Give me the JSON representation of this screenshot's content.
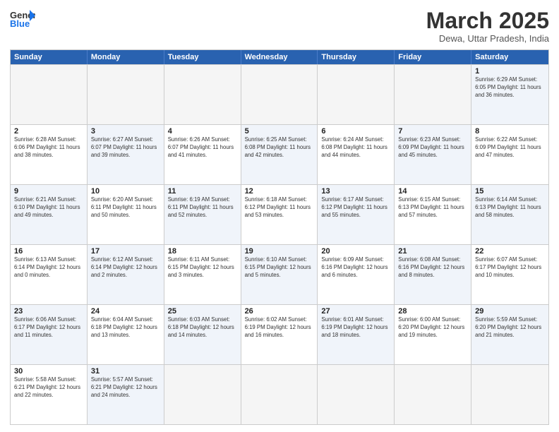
{
  "header": {
    "logo_general": "General",
    "logo_blue": "Blue",
    "month_title": "March 2025",
    "subtitle": "Dewa, Uttar Pradesh, India"
  },
  "days_of_week": [
    "Sunday",
    "Monday",
    "Tuesday",
    "Wednesday",
    "Thursday",
    "Friday",
    "Saturday"
  ],
  "weeks": [
    [
      {
        "day": "",
        "info": "",
        "empty": true
      },
      {
        "day": "",
        "info": "",
        "empty": true
      },
      {
        "day": "",
        "info": "",
        "empty": true
      },
      {
        "day": "",
        "info": "",
        "empty": true
      },
      {
        "day": "",
        "info": "",
        "empty": true
      },
      {
        "day": "",
        "info": "",
        "empty": true
      },
      {
        "day": "1",
        "info": "Sunrise: 6:29 AM\nSunset: 6:05 PM\nDaylight: 11 hours\nand 36 minutes.",
        "alt": true
      }
    ],
    [
      {
        "day": "2",
        "info": "Sunrise: 6:28 AM\nSunset: 6:06 PM\nDaylight: 11 hours\nand 38 minutes."
      },
      {
        "day": "3",
        "info": "Sunrise: 6:27 AM\nSunset: 6:07 PM\nDaylight: 11 hours\nand 39 minutes.",
        "alt": true
      },
      {
        "day": "4",
        "info": "Sunrise: 6:26 AM\nSunset: 6:07 PM\nDaylight: 11 hours\nand 41 minutes."
      },
      {
        "day": "5",
        "info": "Sunrise: 6:25 AM\nSunset: 6:08 PM\nDaylight: 11 hours\nand 42 minutes.",
        "alt": true
      },
      {
        "day": "6",
        "info": "Sunrise: 6:24 AM\nSunset: 6:08 PM\nDaylight: 11 hours\nand 44 minutes."
      },
      {
        "day": "7",
        "info": "Sunrise: 6:23 AM\nSunset: 6:09 PM\nDaylight: 11 hours\nand 45 minutes.",
        "alt": true
      },
      {
        "day": "8",
        "info": "Sunrise: 6:22 AM\nSunset: 6:09 PM\nDaylight: 11 hours\nand 47 minutes."
      }
    ],
    [
      {
        "day": "9",
        "info": "Sunrise: 6:21 AM\nSunset: 6:10 PM\nDaylight: 11 hours\nand 49 minutes.",
        "alt": true
      },
      {
        "day": "10",
        "info": "Sunrise: 6:20 AM\nSunset: 6:11 PM\nDaylight: 11 hours\nand 50 minutes."
      },
      {
        "day": "11",
        "info": "Sunrise: 6:19 AM\nSunset: 6:11 PM\nDaylight: 11 hours\nand 52 minutes.",
        "alt": true
      },
      {
        "day": "12",
        "info": "Sunrise: 6:18 AM\nSunset: 6:12 PM\nDaylight: 11 hours\nand 53 minutes."
      },
      {
        "day": "13",
        "info": "Sunrise: 6:17 AM\nSunset: 6:12 PM\nDaylight: 11 hours\nand 55 minutes.",
        "alt": true
      },
      {
        "day": "14",
        "info": "Sunrise: 6:15 AM\nSunset: 6:13 PM\nDaylight: 11 hours\nand 57 minutes."
      },
      {
        "day": "15",
        "info": "Sunrise: 6:14 AM\nSunset: 6:13 PM\nDaylight: 11 hours\nand 58 minutes.",
        "alt": true
      }
    ],
    [
      {
        "day": "16",
        "info": "Sunrise: 6:13 AM\nSunset: 6:14 PM\nDaylight: 12 hours\nand 0 minutes."
      },
      {
        "day": "17",
        "info": "Sunrise: 6:12 AM\nSunset: 6:14 PM\nDaylight: 12 hours\nand 2 minutes.",
        "alt": true
      },
      {
        "day": "18",
        "info": "Sunrise: 6:11 AM\nSunset: 6:15 PM\nDaylight: 12 hours\nand 3 minutes."
      },
      {
        "day": "19",
        "info": "Sunrise: 6:10 AM\nSunset: 6:15 PM\nDaylight: 12 hours\nand 5 minutes.",
        "alt": true
      },
      {
        "day": "20",
        "info": "Sunrise: 6:09 AM\nSunset: 6:16 PM\nDaylight: 12 hours\nand 6 minutes."
      },
      {
        "day": "21",
        "info": "Sunrise: 6:08 AM\nSunset: 6:16 PM\nDaylight: 12 hours\nand 8 minutes.",
        "alt": true
      },
      {
        "day": "22",
        "info": "Sunrise: 6:07 AM\nSunset: 6:17 PM\nDaylight: 12 hours\nand 10 minutes."
      }
    ],
    [
      {
        "day": "23",
        "info": "Sunrise: 6:06 AM\nSunset: 6:17 PM\nDaylight: 12 hours\nand 11 minutes.",
        "alt": true
      },
      {
        "day": "24",
        "info": "Sunrise: 6:04 AM\nSunset: 6:18 PM\nDaylight: 12 hours\nand 13 minutes."
      },
      {
        "day": "25",
        "info": "Sunrise: 6:03 AM\nSunset: 6:18 PM\nDaylight: 12 hours\nand 14 minutes.",
        "alt": true
      },
      {
        "day": "26",
        "info": "Sunrise: 6:02 AM\nSunset: 6:19 PM\nDaylight: 12 hours\nand 16 minutes."
      },
      {
        "day": "27",
        "info": "Sunrise: 6:01 AM\nSunset: 6:19 PM\nDaylight: 12 hours\nand 18 minutes.",
        "alt": true
      },
      {
        "day": "28",
        "info": "Sunrise: 6:00 AM\nSunset: 6:20 PM\nDaylight: 12 hours\nand 19 minutes."
      },
      {
        "day": "29",
        "info": "Sunrise: 5:59 AM\nSunset: 6:20 PM\nDaylight: 12 hours\nand 21 minutes.",
        "alt": true
      }
    ],
    [
      {
        "day": "30",
        "info": "Sunrise: 5:58 AM\nSunset: 6:21 PM\nDaylight: 12 hours\nand 22 minutes."
      },
      {
        "day": "31",
        "info": "Sunrise: 5:57 AM\nSunset: 6:21 PM\nDaylight: 12 hours\nand 24 minutes.",
        "alt": true
      },
      {
        "day": "",
        "info": "",
        "empty": true
      },
      {
        "day": "",
        "info": "",
        "empty": true
      },
      {
        "day": "",
        "info": "",
        "empty": true
      },
      {
        "day": "",
        "info": "",
        "empty": true
      },
      {
        "day": "",
        "info": "",
        "empty": true
      }
    ]
  ]
}
